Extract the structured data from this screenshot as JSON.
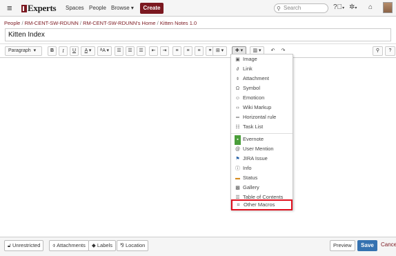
{
  "topbar": {
    "logo": "Experts",
    "nav": [
      "Spaces",
      "People",
      "Browse"
    ],
    "create_label": "Create",
    "search_placeholder": "Search"
  },
  "breadcrumb": [
    "People",
    "RM-CENT-SW-RDUNN",
    "RM-CENT-SW-RDUNN's Home",
    "Kitten Notes 1.0"
  ],
  "page_title": "Kitten Index",
  "toolbar": {
    "paragraph": "Paragraph",
    "bold": "B",
    "italic": "I",
    "underline": "U",
    "textcolor": "A",
    "size": "ᴬA"
  },
  "insert_menu": {
    "group1": [
      {
        "label": "Image",
        "icon": "image-icon"
      },
      {
        "label": "Link",
        "icon": "link-icon"
      },
      {
        "label": "Attachment",
        "icon": "paperclip-icon"
      },
      {
        "label": "Symbol",
        "icon": "omega-icon"
      },
      {
        "label": "Emoticon",
        "icon": "smiley-icon"
      },
      {
        "label": "Wiki Markup",
        "icon": "markup-icon"
      },
      {
        "label": "Horizontal rule",
        "icon": "rule-icon"
      },
      {
        "label": "Task List",
        "icon": "task-icon"
      }
    ],
    "group2": [
      {
        "label": "Evernote",
        "icon": "evernote-icon"
      },
      {
        "label": "User Mention",
        "icon": "at-icon"
      },
      {
        "label": "JIRA Issue",
        "icon": "jira-icon"
      },
      {
        "label": "Info",
        "icon": "info-icon"
      },
      {
        "label": "Status",
        "icon": "status-icon"
      },
      {
        "label": "Gallery",
        "icon": "gallery-icon"
      },
      {
        "label": "Table of Contents",
        "icon": "toc-icon"
      },
      {
        "label": "Other Macros",
        "icon": "macro-icon"
      }
    ]
  },
  "bottombar": {
    "restrictions": "Unrestricted",
    "attachments": "Attachments",
    "labels": "Labels",
    "location": "Location",
    "preview": "Preview",
    "save": "Save",
    "cancel": "Cancel"
  },
  "colors": {
    "brand": "#7b1820",
    "save": "#3572b0",
    "highlight": "#e0101e"
  }
}
